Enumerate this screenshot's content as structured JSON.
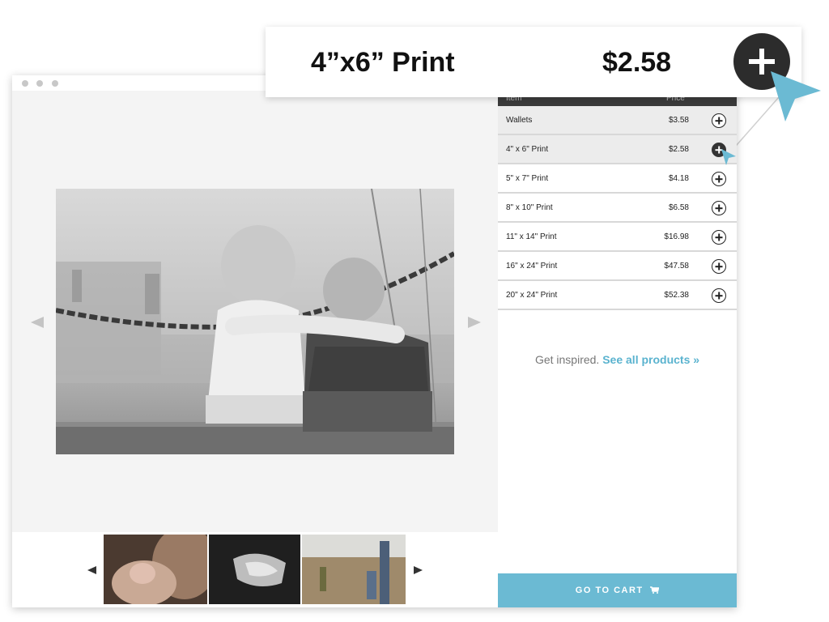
{
  "callout": {
    "item": "4”x6” Print",
    "price": "$2.58"
  },
  "table": {
    "headers": {
      "item": "Item",
      "price": "Price"
    },
    "rows": [
      {
        "name": "Wallets",
        "price": "$3.58"
      },
      {
        "name": "4\" x 6\" Print",
        "price": "$2.58"
      },
      {
        "name": "5\" x 7\" Print",
        "price": "$4.18"
      },
      {
        "name": "8\" x 10\" Print",
        "price": "$6.58"
      },
      {
        "name": "11\" x 14\" Print",
        "price": "$16.98"
      },
      {
        "name": "16\" x 24\" Print",
        "price": "$47.58"
      },
      {
        "name": "20\" x 24\" Print",
        "price": "$52.38"
      }
    ]
  },
  "inspire": {
    "text": "Get inspired.",
    "link": "See all products »"
  },
  "cart": {
    "label": "GO TO CART"
  },
  "icons": {
    "add": "plus-circle-icon",
    "cart": "cart-icon",
    "cursor": "cursor-arrow-icon"
  },
  "colors": {
    "accent": "#6bbad3",
    "link": "#5ab3cf",
    "dark": "#2c2c2c"
  }
}
